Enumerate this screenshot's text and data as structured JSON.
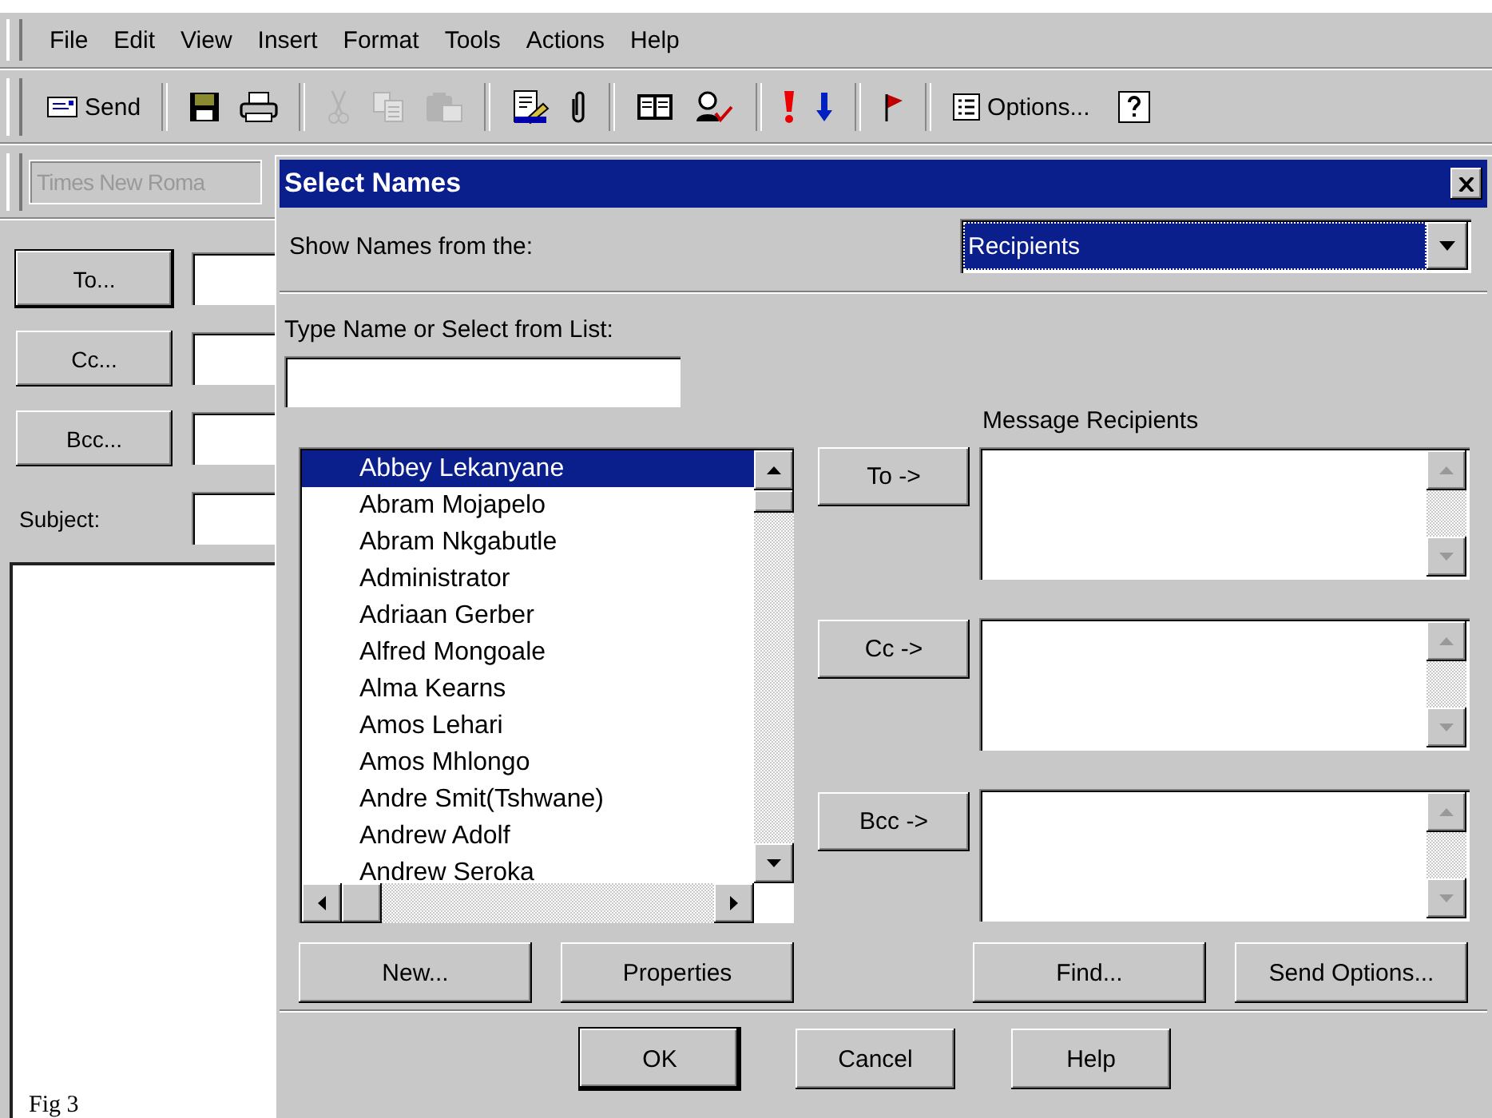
{
  "menu": [
    "File",
    "Edit",
    "View",
    "Insert",
    "Format",
    "Tools",
    "Actions",
    "Help"
  ],
  "toolbar": {
    "groups": [
      [
        {
          "kind": "send",
          "label": "Send",
          "disabled": false
        }
      ],
      [
        {
          "kind": "save",
          "disabled": false
        },
        {
          "kind": "print",
          "disabled": false
        }
      ],
      [
        {
          "kind": "cut",
          "disabled": true
        },
        {
          "kind": "copy",
          "disabled": true
        },
        {
          "kind": "paste",
          "disabled": true
        }
      ],
      [
        {
          "kind": "check",
          "disabled": false
        },
        {
          "kind": "attach",
          "disabled": false
        }
      ],
      [
        {
          "kind": "book",
          "disabled": false
        },
        {
          "kind": "person",
          "disabled": false
        }
      ],
      [
        {
          "kind": "important",
          "disabled": false
        },
        {
          "kind": "low",
          "disabled": false
        }
      ],
      [
        {
          "kind": "flag",
          "disabled": false
        }
      ],
      [
        {
          "kind": "options",
          "label": "Options...",
          "disabled": false
        },
        {
          "kind": "help",
          "disabled": false
        }
      ]
    ]
  },
  "format_bar": {
    "font": "Times New Roma",
    "disabled": true
  },
  "address_buttons": [
    "To...",
    "Cc...",
    "Bcc..."
  ],
  "subject_label": "Subject:",
  "body_text": "Fig 3",
  "dialog": {
    "title": "Select Names",
    "show_label": "Show Names from the:",
    "source": {
      "value": "Recipients",
      "focused": true
    },
    "type_label": "Type Name or Select from List:",
    "names": [
      {
        "name": "Abbey Lekanyane",
        "selected": true
      },
      {
        "name": "Abram Mojapelo",
        "selected": false
      },
      {
        "name": "Abram Nkgabutle",
        "selected": false
      },
      {
        "name": "Administrator",
        "selected": false
      },
      {
        "name": "Adriaan Gerber",
        "selected": false
      },
      {
        "name": "Alfred Mongoale",
        "selected": false
      },
      {
        "name": "Alma Kearns",
        "selected": false
      },
      {
        "name": "Amos Lehari",
        "selected": false
      },
      {
        "name": "Amos Mhlongo",
        "selected": false
      },
      {
        "name": "Andre Smit(Tshwane)",
        "selected": false
      },
      {
        "name": "Andrew Adolf",
        "selected": false
      },
      {
        "name": "Andrew Seroka",
        "selected": false
      }
    ],
    "add_buttons": [
      "To ->",
      "Cc ->",
      "Bcc ->"
    ],
    "recipients_label": "Message Recipients",
    "list_buttons": [
      "New...",
      "Properties"
    ],
    "recipient_buttons": [
      "Find...",
      "Send Options..."
    ],
    "footer_buttons": [
      {
        "label": "OK",
        "default": true
      },
      {
        "label": "Cancel",
        "default": false
      },
      {
        "label": "Help",
        "default": false
      }
    ]
  }
}
